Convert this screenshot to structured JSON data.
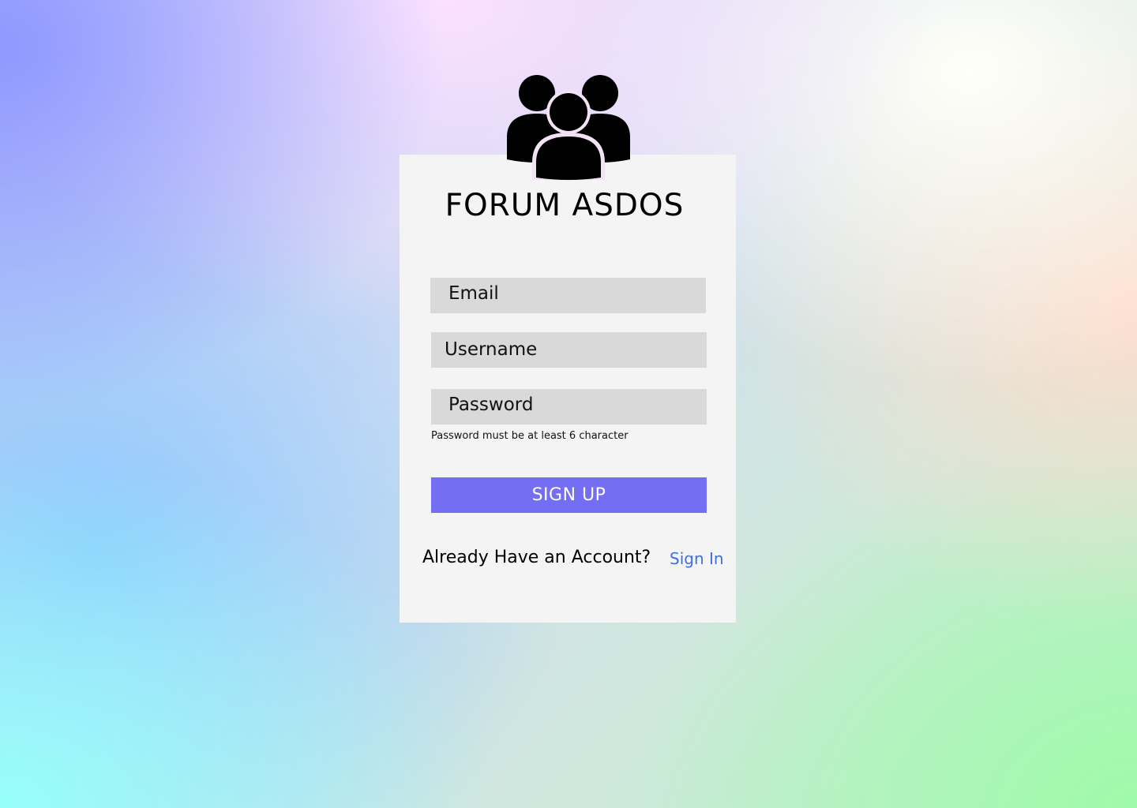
{
  "app": {
    "title": "FORUM ASDOS",
    "logo_icon": "users-group-icon"
  },
  "form": {
    "email_placeholder": "Email",
    "username_placeholder": "Username",
    "password_placeholder": "Password",
    "password_hint": "Password must be at least 6 character",
    "submit_label": "SIGN UP"
  },
  "footer": {
    "prompt": "Already Have an Account?",
    "signin_label": "Sign In"
  },
  "colors": {
    "card_background": "#f4f4f4",
    "input_background": "#d9d9d9",
    "primary_button": "#736ef2",
    "link": "#3f6fe0"
  }
}
